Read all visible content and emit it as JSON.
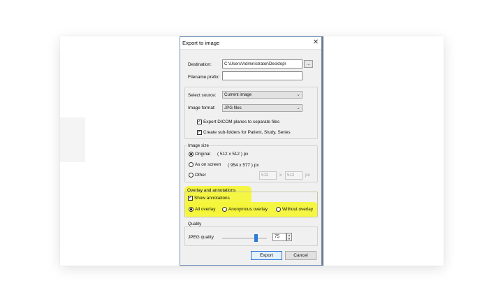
{
  "dialog": {
    "title": "Export to image",
    "close_glyph": "✕"
  },
  "destination": {
    "label": "Destination:",
    "value": "C:\\Users\\Administrator\\Desktop\\",
    "browse_label": "..."
  },
  "filename_prefix": {
    "label": "Filename prefix:",
    "value": ""
  },
  "source": {
    "label": "Select source:",
    "selected": "Current image"
  },
  "format": {
    "label": "Image format:",
    "selected": "JPG files"
  },
  "options": {
    "export_planes": {
      "label": "Export DICOM planes to separate files",
      "checked": true
    },
    "subfolders": {
      "label": "Create sub-folders for Patient, Study, Series",
      "checked": true
    }
  },
  "image_size": {
    "title": "Image size",
    "original_label": "Original",
    "original_dims": "( 512 x 512 ) px",
    "on_screen_label": "As on screen",
    "on_screen_dims": "( 954 x 577 ) px",
    "other_label": "Other",
    "other_width": "512",
    "other_sep": "x",
    "other_height": "512",
    "other_unit": "px",
    "selected": "original"
  },
  "overlay": {
    "title": "Overlay and annotations",
    "show_annotations_label": "Show annotations",
    "show_annotations_checked": true,
    "all_overlay_label": "All overlay",
    "anonymous_overlay_label": "Anonymous overlay",
    "without_overlay_label": "Without overlay",
    "selected": "all",
    "highlight_color": "#f4f63a"
  },
  "quality": {
    "title": "Quality",
    "jpeg_label": "JPEG quality",
    "value": "75",
    "slider_fraction": 0.75
  },
  "buttons": {
    "export_label": "Export",
    "cancel_label": "Cancel"
  },
  "colors": {
    "accent": "#2a7ad6",
    "dialog_bg": "#f0f0f0"
  }
}
